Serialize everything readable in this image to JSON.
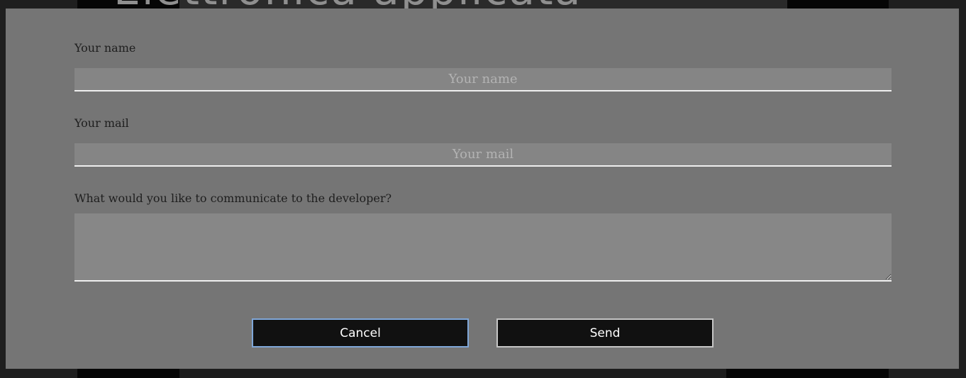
{
  "background": {
    "heading": "Elettronica applicata"
  },
  "form": {
    "name_label": "Your name",
    "name_placeholder": "Your name",
    "name_value": "",
    "mail_label": "Your mail",
    "mail_placeholder": "Your mail",
    "mail_value": "",
    "message_label": "What would you like to communicate to the developer?",
    "message_value": ""
  },
  "buttons": {
    "cancel_label": "Cancel",
    "send_label": "Send"
  },
  "colors": {
    "overlay": "#757575",
    "input_background": "#858585",
    "button_background": "#111111",
    "focus_outline": "#7fa7d9"
  }
}
